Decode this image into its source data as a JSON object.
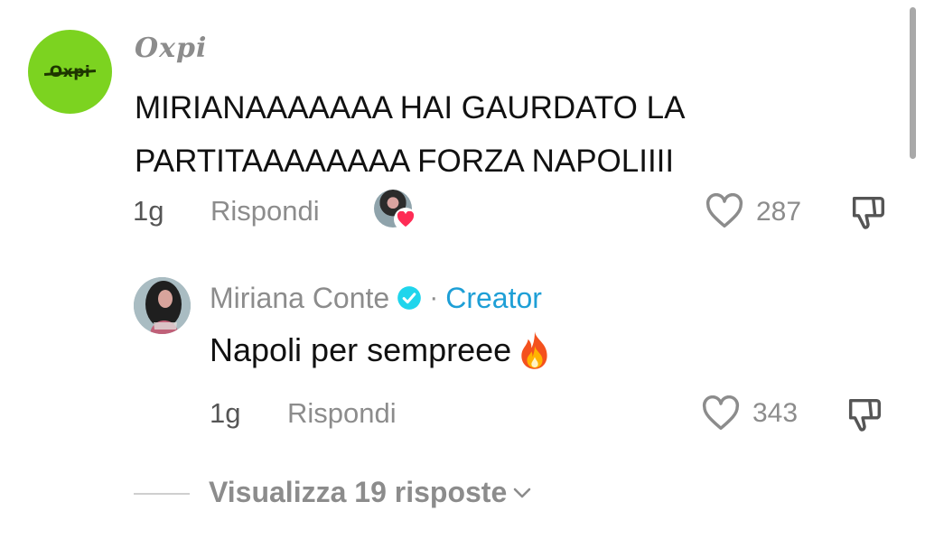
{
  "comment": {
    "username": "Oxpi",
    "avatar_logo_text": "Oxpi",
    "text": "MIRIANAAAAAAA HAI GAURDATO LA PARTITAAAAAAAA FORZA NAPOLIIII",
    "time": "1g",
    "reply_label": "Rispondi",
    "creator_liked": true,
    "like_count": "287",
    "icons": [
      "heart-outline-icon",
      "dislike-icon",
      "heart-filled-icon"
    ]
  },
  "reply": {
    "username": "Miriana Conte",
    "verified": true,
    "separator": "·",
    "creator_label": "Creator",
    "text": "Napoli per sempreee",
    "emoji": "fire",
    "time": "1g",
    "reply_label": "Rispondi",
    "like_count": "343"
  },
  "view_replies": {
    "label": "Visualizza 19 risposte"
  },
  "colors": {
    "accent_blue": "#1e9fd6",
    "avatar_green": "#7cd320",
    "heart_red": "#fe2c55",
    "muted_text": "#8c8c8c"
  }
}
